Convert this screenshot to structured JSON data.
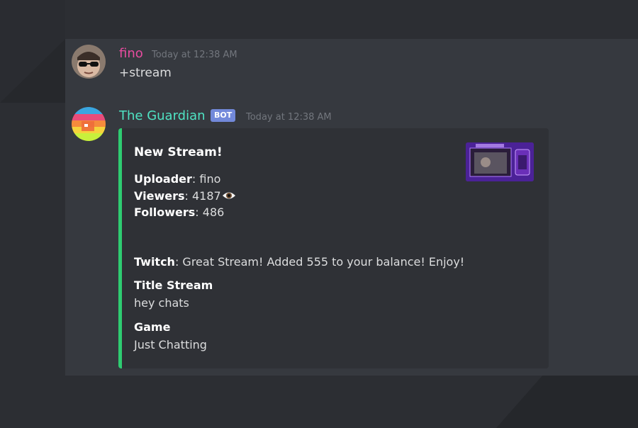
{
  "colors": {
    "background": "#2c2e33",
    "panel": "#36393f",
    "embed_background": "#2f3136",
    "embed_accent": "#2ecc71",
    "user1_name": "#e84ca0",
    "user2_name": "#4fe3c3",
    "bot_tag": "#7289da"
  },
  "messages": [
    {
      "username": "fino",
      "timestamp": "Today at 12:38 AM",
      "content": "+stream",
      "avatar_icon": "sunglasses-avatar-icon"
    },
    {
      "username": "The Guardian",
      "bot_tag": "BOT",
      "timestamp": "Today at 12:38 AM",
      "avatar_icon": "rainbow-avatar-icon",
      "embed": {
        "title": "New Stream!",
        "uploader_label": "Uploader",
        "uploader_value": ": fino",
        "viewers_label": "Viewers",
        "viewers_value": ": 4187",
        "viewers_icon": "eye-icon",
        "followers_label": "Followers",
        "followers_value": ": 486",
        "twitch_label": "Twitch",
        "twitch_value": ": Great Stream! Added 555 to your balance! Enjoy!",
        "fields": [
          {
            "name": "Title Stream",
            "value": "hey chats"
          },
          {
            "name": "Game",
            "value": "Just Chatting"
          }
        ],
        "thumbnail_icon": "stream-thumbnail-image"
      }
    }
  ]
}
